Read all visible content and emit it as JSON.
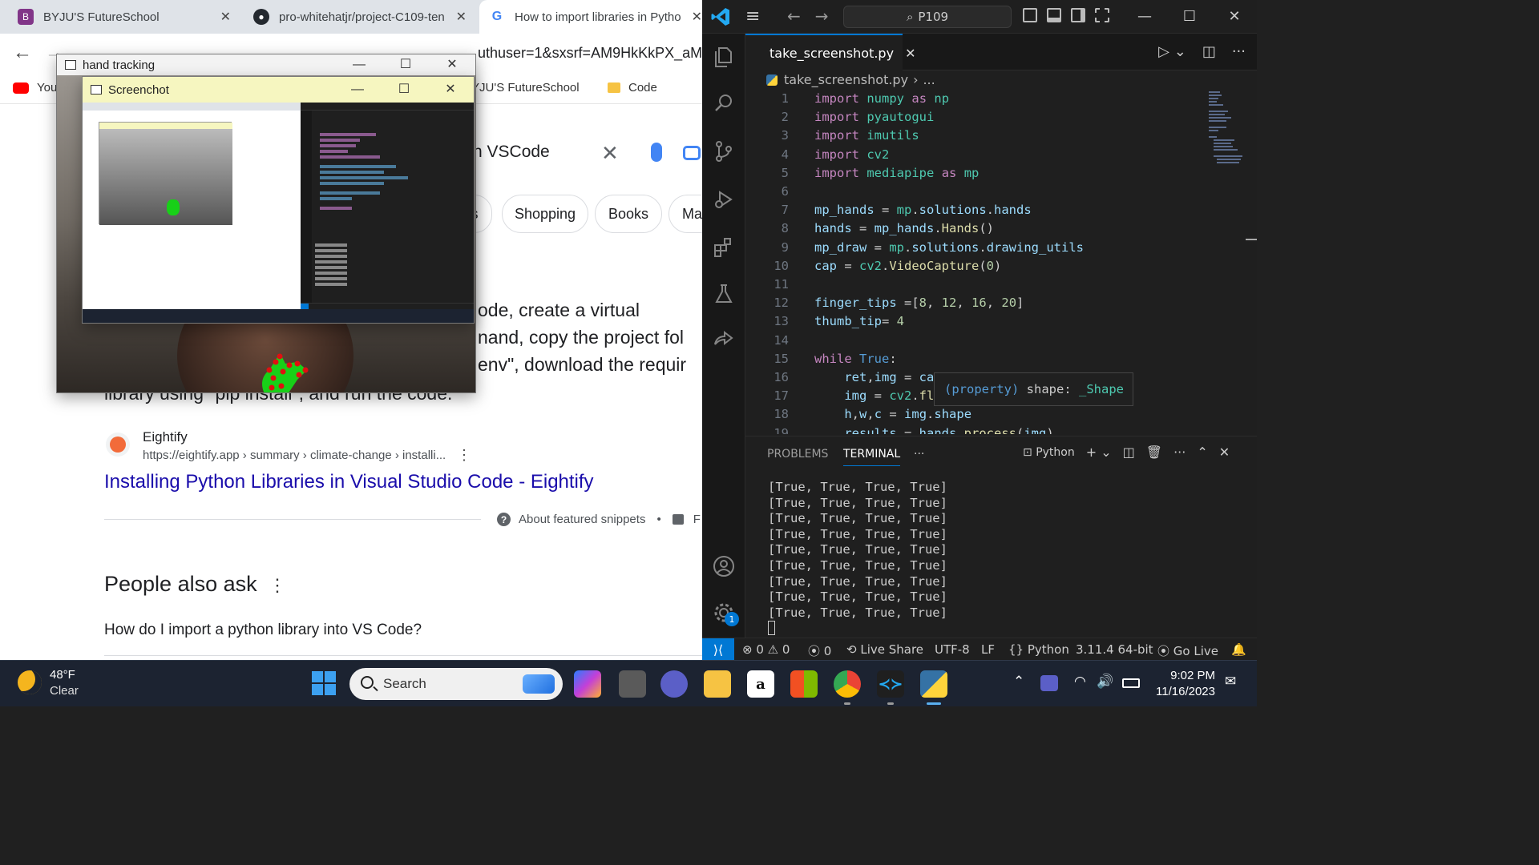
{
  "browser": {
    "tabs": [
      {
        "title": "BYJU'S FutureSchool",
        "favicon_color": "#813588"
      },
      {
        "title": "pro-whitehatjr/project-C109-ten",
        "favicon_color": "#24292f"
      },
      {
        "title": "How to import libraries in Pytho",
        "favicon_color": "#ffffff"
      }
    ],
    "url_tail": "uthuser=1&sxsrf=AM9HkKkPX_aMm",
    "bookmarks": [
      {
        "label": "You"
      },
      {
        "label": "BYJU'S FutureSchool"
      },
      {
        "label": "Code"
      }
    ],
    "search_query_tail": "n VSCode",
    "chips": [
      "s",
      "Shopping",
      "Books",
      "Ma"
    ],
    "snippet_lines": [
      "ode, create a virtual",
      "nand, copy the project fol",
      "env\", download the requir"
    ],
    "snippet_line4": "library using \"pip install\", and run the code.",
    "result": {
      "source_name": "Eightify",
      "source_url": "https://eightify.app › summary › climate-change › installi...",
      "title": "Installing Python Libraries in Visual Studio Code - Eightify"
    },
    "about_snippets": "About featured snippets",
    "about_sep": "•",
    "about_tail": "F",
    "people_also_ask": "People also ask",
    "paa_question": "How do I import a python library into VS Code?"
  },
  "windows": {
    "hand_tracking": {
      "title": "hand tracking"
    },
    "screenshot": {
      "title": "Screenchot"
    }
  },
  "vscode": {
    "command_center": "P109",
    "tab": "take_screenshot.py",
    "breadcrumb": [
      "take_screenshot.py",
      "..."
    ],
    "code_lines": [
      {
        "n": "1",
        "t": "import numpy as np"
      },
      {
        "n": "2",
        "t": "import pyautogui"
      },
      {
        "n": "3",
        "t": "import imutils"
      },
      {
        "n": "4",
        "t": "import cv2"
      },
      {
        "n": "5",
        "t": "import mediapipe as mp"
      },
      {
        "n": "6",
        "t": ""
      },
      {
        "n": "7",
        "t": "mp_hands = mp.solutions.hands"
      },
      {
        "n": "8",
        "t": "hands = mp_hands.Hands()"
      },
      {
        "n": "9",
        "t": "mp_draw = mp.solutions.drawing_utils"
      },
      {
        "n": "10",
        "t": "cap = cv2.VideoCapture(0)"
      },
      {
        "n": "11",
        "t": ""
      },
      {
        "n": "12",
        "t": "finger_tips =[8, 12, 16, 20]"
      },
      {
        "n": "13",
        "t": "thumb_tip= 4"
      },
      {
        "n": "14",
        "t": ""
      },
      {
        "n": "15",
        "t": "while True:"
      },
      {
        "n": "16",
        "t": "    ret,img = ca"
      },
      {
        "n": "17",
        "t": "    img = cv2.fl"
      },
      {
        "n": "18",
        "t": "    h,w,c = img.shape"
      },
      {
        "n": "19",
        "t": "    results = hands.process(img)"
      }
    ],
    "hover": {
      "kind": "(property)",
      "name": "shape:",
      "type": "_Shape"
    },
    "panel_tabs": [
      "PROBLEMS",
      "TERMINAL",
      "···"
    ],
    "terminal_profile": "Python",
    "terminal_lines": [
      "[True, True, True, True]",
      "[True, True, True, True]",
      "[True, True, True, True]",
      "[True, True, True, True]",
      "[True, True, True, True]",
      "[True, True, True, True]",
      "[True, True, True, True]",
      "[True, True, True, True]",
      "[True, True, True, True]"
    ],
    "status": {
      "errors": "0",
      "warnings": "0",
      "ports": "0",
      "live_share": "Live Share",
      "encoding": "UTF-8",
      "eol": "LF",
      "language": "Python",
      "interpreter": "3.11.4 64-bit",
      "go_live": "Go Live"
    },
    "accounts_badge": "1"
  },
  "taskbar": {
    "weather_temp": "48°F",
    "weather_desc": "Clear",
    "search_placeholder": "Search",
    "time": "9:02 PM",
    "date": "11/16/2023",
    "icons": [
      "windows-start",
      "copilot",
      "task-view",
      "meet",
      "file-explorer",
      "amazon",
      "store",
      "chrome",
      "vscode",
      "python"
    ]
  }
}
